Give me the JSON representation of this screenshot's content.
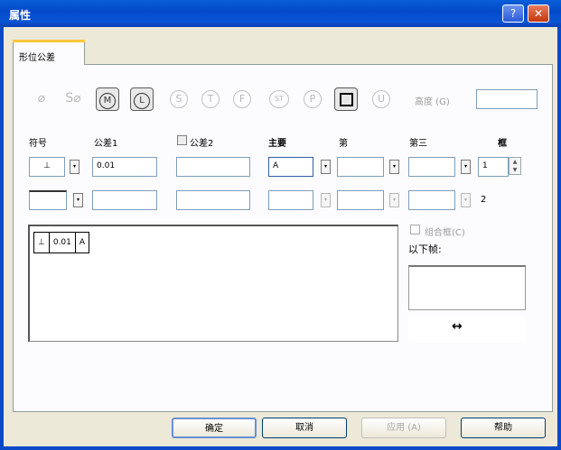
{
  "window": {
    "title": "属性",
    "help_glyph": "?",
    "close_glyph": "✕"
  },
  "tabs": [
    {
      "label": "形位公差"
    }
  ],
  "symbols": [
    {
      "name": "diameter",
      "glyph": "⌀",
      "state": "disabled"
    },
    {
      "name": "spherical-diameter",
      "glyph": "S⌀",
      "state": "disabled"
    },
    {
      "name": "max-material",
      "glyph": "M",
      "state": "active"
    },
    {
      "name": "least-material",
      "glyph": "L",
      "state": "active"
    },
    {
      "name": "rfs",
      "glyph": "S",
      "state": "disabled"
    },
    {
      "name": "tangent-plane",
      "glyph": "T",
      "state": "disabled"
    },
    {
      "name": "free-state",
      "glyph": "F",
      "state": "disabled"
    },
    {
      "name": "statistical",
      "glyph": "ST",
      "state": "disabled"
    },
    {
      "name": "projected",
      "glyph": "P",
      "state": "disabled"
    },
    {
      "name": "square",
      "glyph": "",
      "state": "active"
    },
    {
      "name": "unilateral",
      "glyph": "U",
      "state": "disabled"
    }
  ],
  "height_label": "高度 (G)",
  "headers": {
    "symbol": "符号",
    "tolerance1": "公差1",
    "tolerance2": "公差2",
    "primary": "主要",
    "secondary": "第",
    "tertiary": "第三",
    "frame": "框"
  },
  "row1": {
    "symbol_value": "⊥",
    "tolerance1": "0.01",
    "primary": "A",
    "frame_number": "1"
  },
  "row2": {
    "frame_number": "2"
  },
  "preview": {
    "symbol": "⊥",
    "tolerance": "0.01",
    "datum": "A"
  },
  "compose_label": "组合框(C)",
  "next_label": "以下帧:",
  "arrow": "↔",
  "buttons": {
    "ok": "确定",
    "cancel": "取消",
    "apply": "应用 (A)",
    "help": "帮助"
  }
}
